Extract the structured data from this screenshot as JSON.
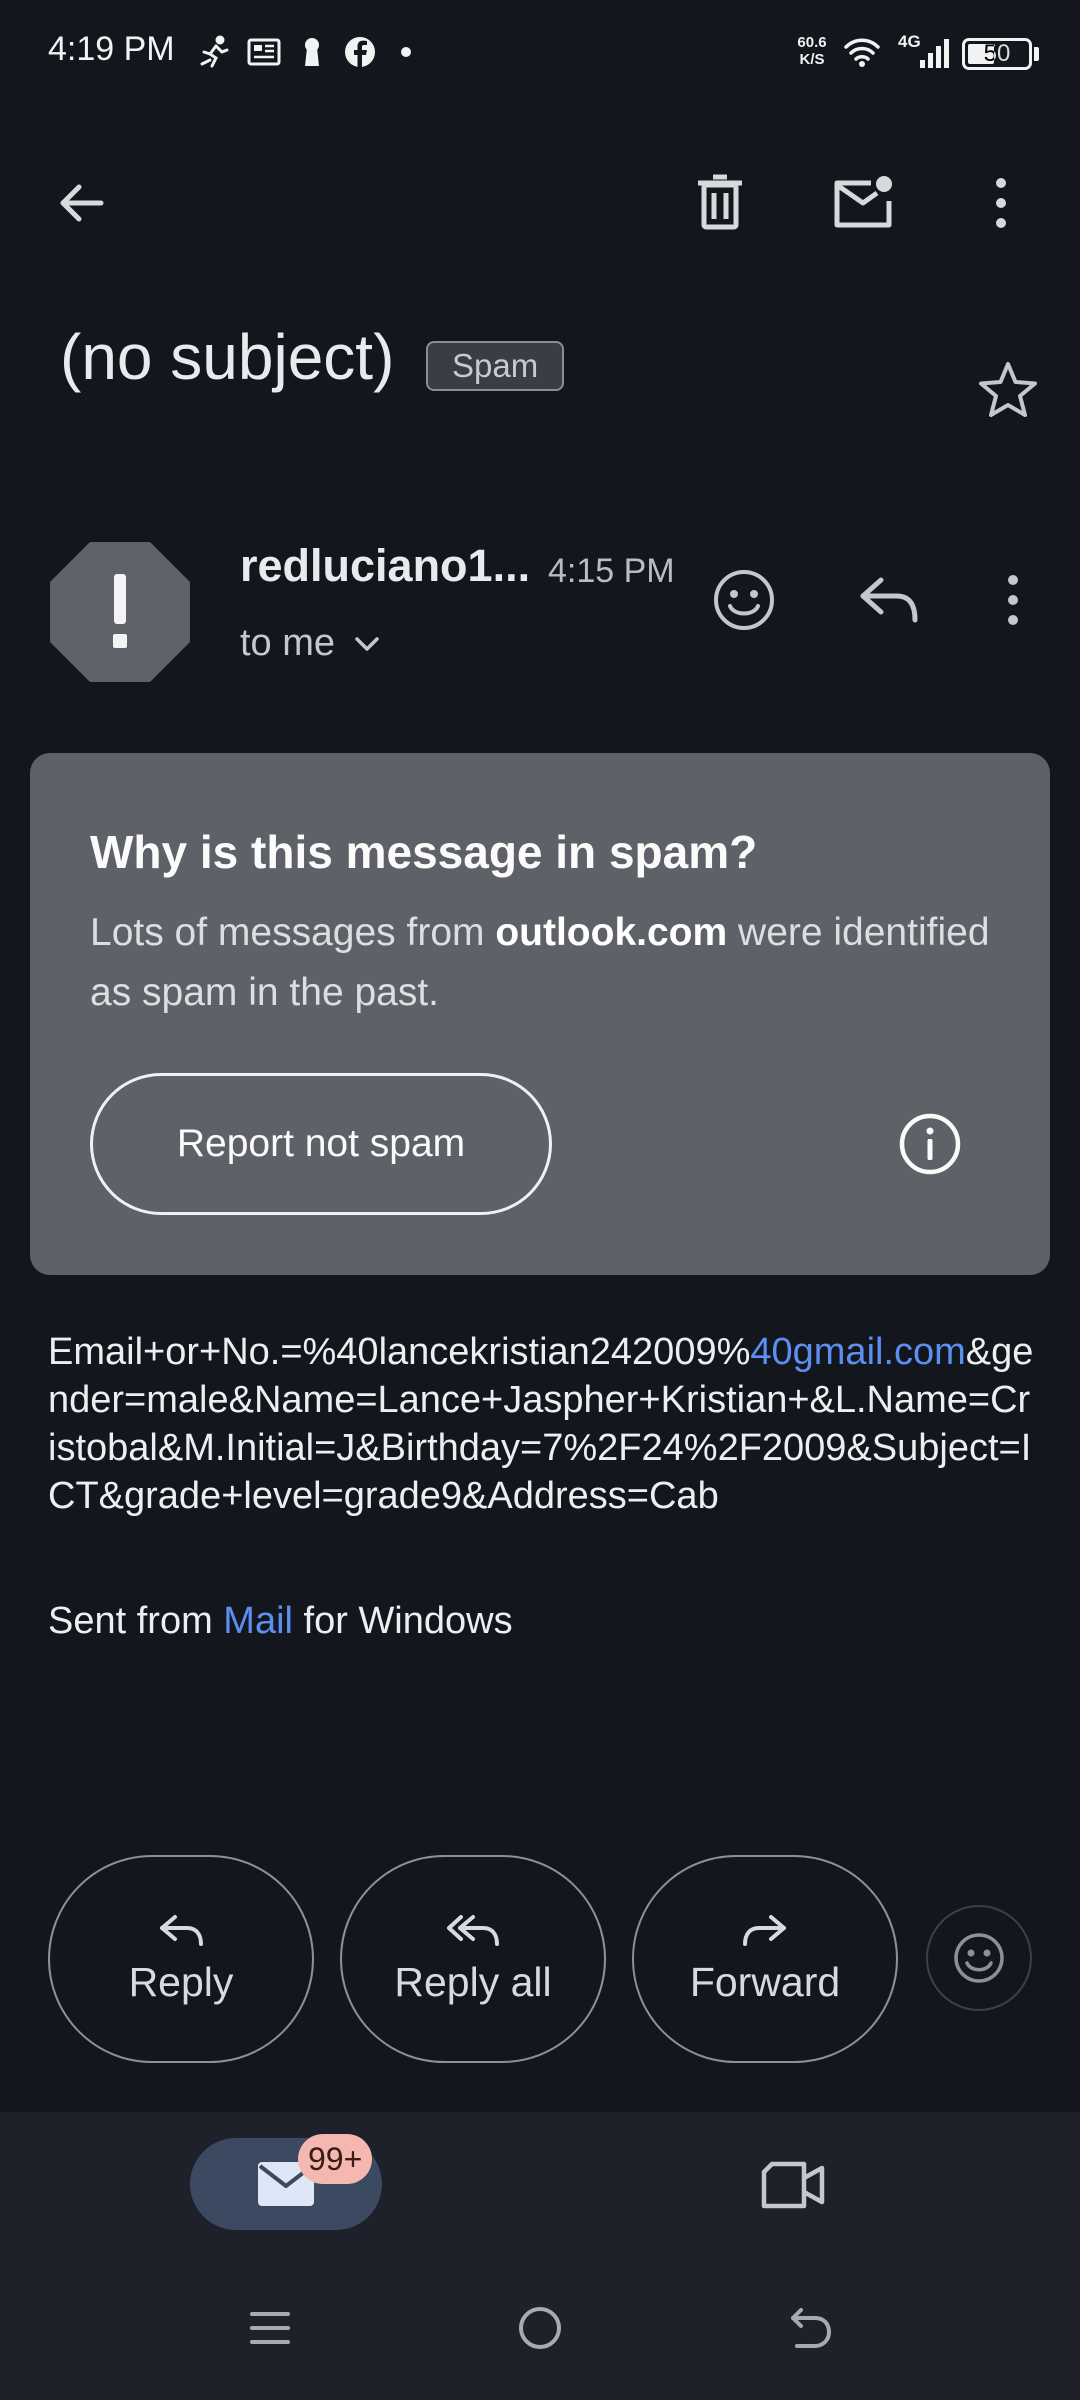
{
  "status_bar": {
    "time": "4:19 PM",
    "net_speed_value": "60.6",
    "net_speed_unit": "K/S",
    "network_type": "4G",
    "battery_level": "50",
    "battery_fraction": 0.5,
    "icons": [
      "running-icon",
      "news-icon",
      "keyhole-icon",
      "facebook-icon",
      "dot-icon",
      "wifi-icon",
      "signal-icon",
      "battery-icon"
    ]
  },
  "app_bar": {
    "icons": [
      "back-arrow-icon",
      "delete-icon",
      "mark-unread-icon",
      "more-vert-icon"
    ]
  },
  "email": {
    "subject": "(no subject)",
    "label": "Spam",
    "sender": "redluciano1...",
    "time": "4:15 PM",
    "recipient": "to me",
    "body_part1": "Email+or+No.=%40lancekristian242009%",
    "body_link": "40gmail.com",
    "body_part2": "&gender=male&Name=Lance+Jaspher+Kristian+&L.Name=Cristobal&M.Initial=J&Birthday=7%2F24%2F2009&Subject=ICT&grade+level=grade9&Address=Cab",
    "signature_pre": "Sent from ",
    "signature_link": "Mail",
    "signature_post": " for Windows"
  },
  "spam_card": {
    "title": "Why is this message in spam?",
    "desc_pre": "Lots of messages from ",
    "desc_domain": "outlook.com",
    "desc_post": " were identified as spam in the past.",
    "button": "Report not spam"
  },
  "actions": {
    "reply": "Reply",
    "reply_all": "Reply all",
    "forward": "Forward"
  },
  "bottom_nav": {
    "mail_badge": "99+"
  },
  "colors": {
    "background": "#13161d",
    "card": "#5e6167",
    "link": "#5b8ff0",
    "badge": "#f4b8b1",
    "active_tab": "#3c4a61"
  }
}
